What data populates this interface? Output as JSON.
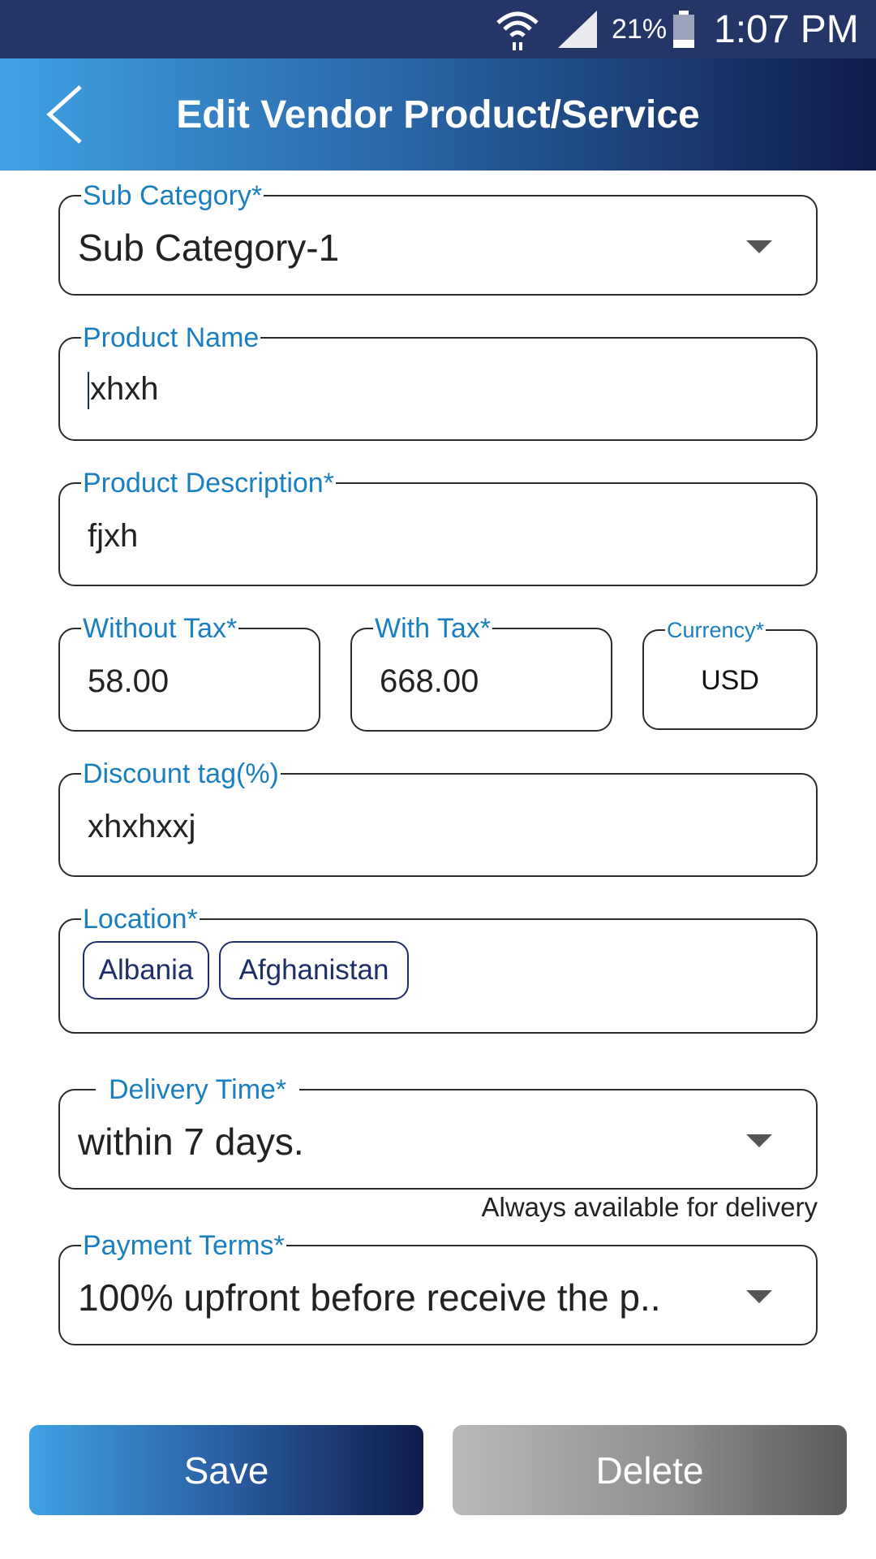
{
  "status_bar": {
    "battery": "21%",
    "time": "1:07 PM",
    "icons": [
      "wifi-icon",
      "signal-icon",
      "battery-icon"
    ]
  },
  "header": {
    "title": "Edit Vendor Product/Service",
    "back_icon": "chevron-left-icon"
  },
  "form": {
    "sub_category": {
      "label": "Sub Category*",
      "value": "Sub Category-1"
    },
    "product_name": {
      "label": "Product Name",
      "value": "xhxh"
    },
    "product_description": {
      "label": "Product Description*",
      "value": "fjxh"
    },
    "without_tax": {
      "label": "Without Tax*",
      "value": "58.00"
    },
    "with_tax": {
      "label": "With Tax*",
      "value": "668.00"
    },
    "currency": {
      "label": "Currency*",
      "value": "USD"
    },
    "discount_tag": {
      "label": "Discount tag(%)",
      "value": "xhxhxxj"
    },
    "location": {
      "label": "Location*",
      "chips": [
        "Albania",
        "Afghanistan"
      ]
    },
    "delivery_time": {
      "label": "Delivery Time*",
      "value": "within 7 days.",
      "helper": "Always available for delivery"
    },
    "payment_terms": {
      "label": "Payment Terms*",
      "value": "100% upfront before receive the p.."
    }
  },
  "actions": {
    "save_label": "Save",
    "delete_label": "Delete"
  },
  "colors": {
    "status_bar": "#243568",
    "accent_label": "#1a7fc1",
    "chip_border": "#1e2e6a"
  }
}
